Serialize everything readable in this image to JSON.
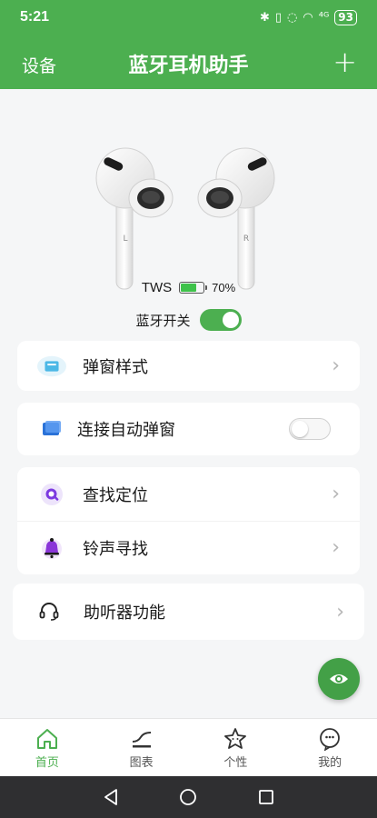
{
  "status_bar": {
    "time": "5:21",
    "signal_text": "⁴ᴳ",
    "battery": "93"
  },
  "app_bar": {
    "left_label": "设备",
    "title": "蓝牙耳机助手",
    "plus_label": "+"
  },
  "device": {
    "left_bud_letter": "L",
    "right_bud_letter": "R",
    "model": "TWS",
    "battery_text": "70%",
    "battery_level": 0.7,
    "bluetooth_label": "蓝牙开关",
    "bluetooth_on": true
  },
  "menu": {
    "popup_style": "弹窗样式",
    "auto_popup": "连接自动弹窗",
    "find_location": "查找定位",
    "ring_find": "铃声寻找",
    "hearing_aid": "助听器功能"
  },
  "tabs": [
    {
      "label": "首页",
      "icon": "home-icon",
      "active": true
    },
    {
      "label": "图表",
      "icon": "chart-icon",
      "active": false
    },
    {
      "label": "个性",
      "icon": "star-face-icon",
      "active": false
    },
    {
      "label": "我的",
      "icon": "profile-face-icon",
      "active": false
    }
  ],
  "colors": {
    "accent": "#4caf50",
    "battery_fill": "#3ec24a",
    "nav_bar": "#2f2f31"
  }
}
